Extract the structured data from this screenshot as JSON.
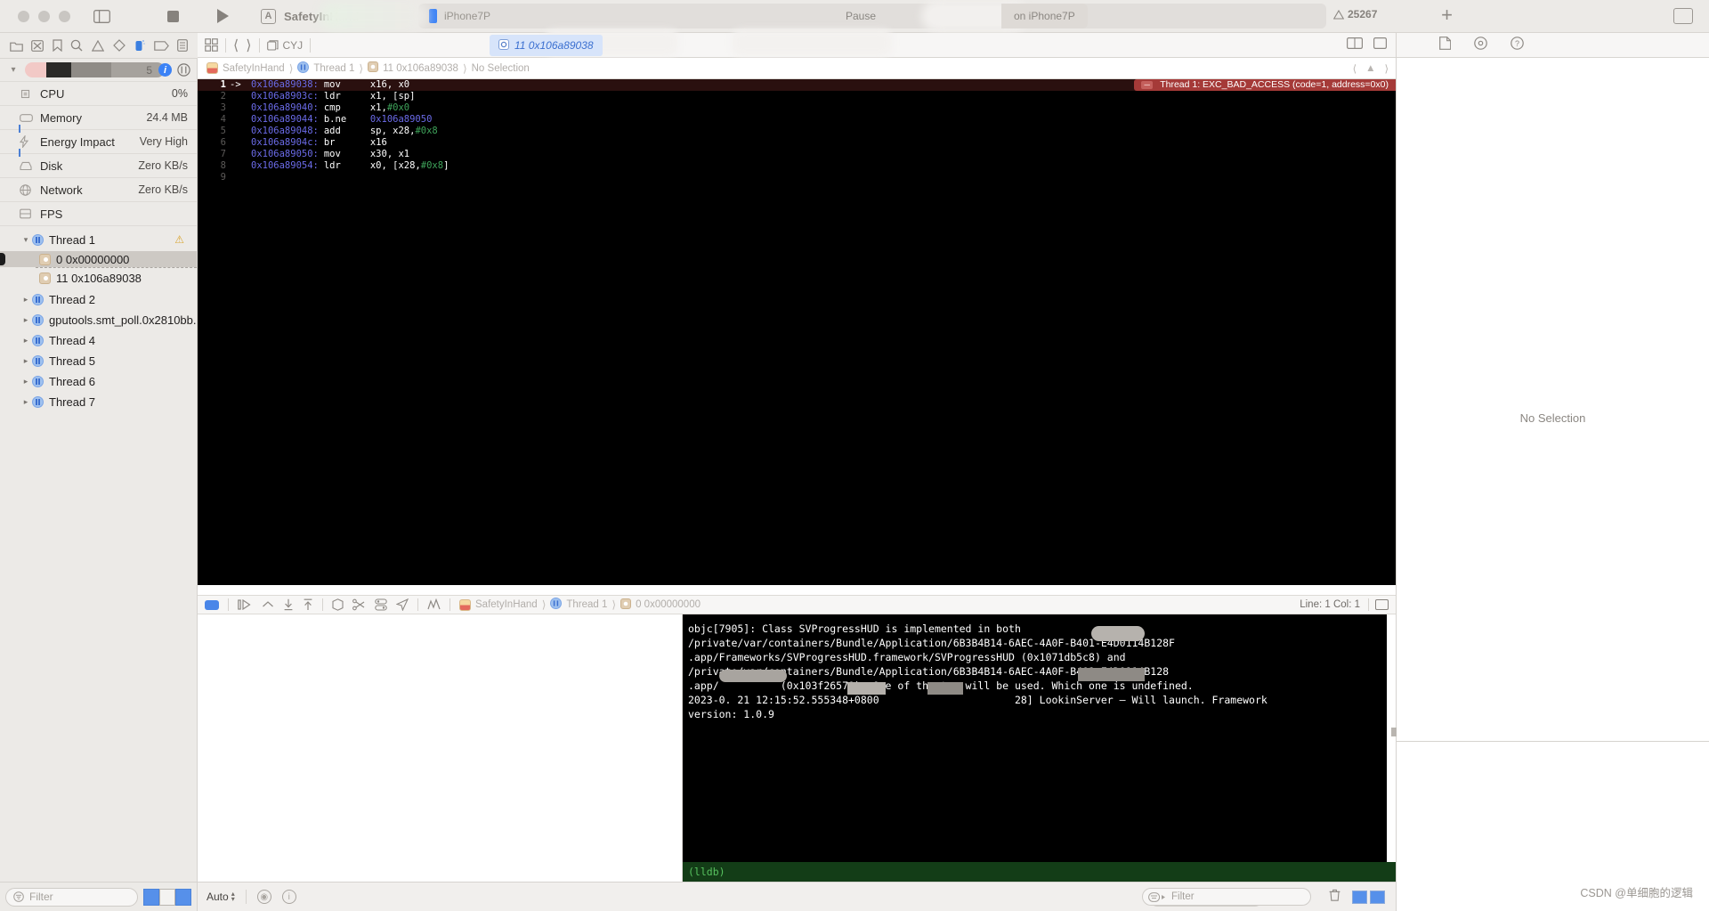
{
  "toolbar": {
    "scheme_name": "SafetyInHand",
    "device_name": "iPhone7P",
    "status_text": "Pause",
    "target_text": "on iPhone7P",
    "warning_count": "25267",
    "stop_icon": "stop-icon",
    "run_icon": "run-icon",
    "sidebar_toggle_icon": "sidebar-toggle-icon",
    "add_icon": "plus-icon",
    "inspector_toggle_icon": "inspector-toggle-icon",
    "app_badge_glyph": "A"
  },
  "navigator": {
    "filter_icons": [
      "folder-icon",
      "source-control-icon",
      "bookmark-icon",
      "search-icon",
      "issue-warning-icon",
      "test-diamond-icon",
      "debug-gauge-icon",
      "breakpoint-icon",
      "report-icon"
    ],
    "gauge_row": {
      "value": "5"
    },
    "metrics": [
      {
        "icon": "cpu-icon",
        "label": "CPU",
        "value": "0%"
      },
      {
        "icon": "memory-icon",
        "label": "Memory",
        "value": "24.4 MB"
      },
      {
        "icon": "energy-icon",
        "label": "Energy Impact",
        "value": "Very High"
      },
      {
        "icon": "disk-icon",
        "label": "Disk",
        "value": "Zero KB/s"
      },
      {
        "icon": "network-icon",
        "label": "Network",
        "value": "Zero KB/s"
      },
      {
        "icon": "fps-icon",
        "label": "FPS",
        "value": ""
      }
    ],
    "threads": [
      {
        "label": "Thread 1",
        "expanded": true,
        "warning": "⚠",
        "kind": "thread"
      },
      {
        "label": "0 0x00000000",
        "kind": "frame",
        "selected": true
      },
      {
        "label": "11 0x106a89038",
        "kind": "frame",
        "selected": false
      },
      {
        "label": "Thread 2",
        "expanded": false,
        "kind": "thread"
      },
      {
        "label": "gputools.smt_poll.0x2810bb...",
        "expanded": false,
        "kind": "thread"
      },
      {
        "label": "Thread 4",
        "expanded": false,
        "kind": "thread"
      },
      {
        "label": "Thread 5",
        "expanded": false,
        "kind": "thread"
      },
      {
        "label": "Thread 6",
        "expanded": false,
        "kind": "thread"
      },
      {
        "label": "Thread 7",
        "expanded": false,
        "kind": "thread"
      }
    ],
    "filter_placeholder": "Filter"
  },
  "jumpbar": {
    "grid_icon": "related-items-icon",
    "back_icon": "back-chevron-icon",
    "forward_icon": "forward-chevron-icon",
    "project_chip": "CYJ",
    "active_tab": "11 0x106a89038"
  },
  "breadcrumb": {
    "items": [
      "SafetyInHand",
      "Thread 1",
      "11 0x106a89038",
      "No Selection"
    ],
    "separator": "⟩"
  },
  "editor": {
    "error_banner": "Thread 1: EXC_BAD_ACCESS (code=1, address=0x0)",
    "pc_marker": "->",
    "lines": [
      {
        "n": "1",
        "pc": true,
        "addr": "0x106a89038:",
        "mnem": "mov",
        "ops": "x16, x0",
        "imm": ""
      },
      {
        "n": "2",
        "pc": false,
        "addr": "0x106a8903c:",
        "mnem": "ldr",
        "ops": "x1, [sp]",
        "imm": ""
      },
      {
        "n": "3",
        "pc": false,
        "addr": "0x106a89040:",
        "mnem": "cmp",
        "ops": "x1, ",
        "imm": "#0x0"
      },
      {
        "n": "4",
        "pc": false,
        "addr": "0x106a89044:",
        "mnem": "b.ne",
        "ops": "",
        "imm": "",
        "jump": "0x106a89050"
      },
      {
        "n": "5",
        "pc": false,
        "addr": "0x106a89048:",
        "mnem": "add",
        "ops": "sp, x28, ",
        "imm": "#0x8"
      },
      {
        "n": "6",
        "pc": false,
        "addr": "0x106a8904c:",
        "mnem": "br",
        "ops": "x16",
        "imm": ""
      },
      {
        "n": "7",
        "pc": false,
        "addr": "0x106a89050:",
        "mnem": "mov",
        "ops": "x30, x1",
        "imm": ""
      },
      {
        "n": "8",
        "pc": false,
        "addr": "0x106a89054:",
        "mnem": "ldr",
        "ops": "x0, [x28, ",
        "imm": "#0x8",
        "tail": "]"
      },
      {
        "n": "9",
        "pc": false,
        "addr": "",
        "mnem": "",
        "ops": "",
        "imm": ""
      }
    ],
    "status": {
      "line_col": "Line: 1  Col: 1"
    }
  },
  "debug_bar": {
    "icons": [
      "continue-icon",
      "step-over-icon",
      "step-into-icon",
      "step-out-icon",
      "view-hierarchy-icon",
      "memory-graph-icon",
      "environment-overrides-icon",
      "simulate-location-icon",
      "gpu-debug-icon"
    ],
    "crumbs": [
      "SafetyInHand",
      "Thread 1",
      "0 0x00000000"
    ]
  },
  "console": {
    "lines": [
      "objc[7905]: Class SVProgressHUD is implemented in both",
      "/private/var/containers/Bundle/Application/6B3B4B14-6AEC-4A0F-B401-E4D0114B128F",
      ".app/Frameworks/SVProgressHUD.framework/SVProgressHUD (0x1071db5c8) and",
      "/private/var/containers/Bundle/Application/6B3B4B14-6AEC-4A0F-B401-E4D0114B128",
      ".app/          (0x103f26570). One of the two will be used. Which one is undefined.",
      "2023-0. 21 12:15:52.555348+0800                      28] LookinServer — Will launch. Framework",
      "version: 1.0.9"
    ],
    "prompt": "(lldb)"
  },
  "debug_footer": {
    "auto_label": "Auto",
    "variables_filter_placeholder": "Filter",
    "console_filter_placeholder": "Filter",
    "trash_icon": "trash-icon",
    "eye_icon": "eye-icon",
    "info_icon": "info-icon"
  },
  "inspector": {
    "icons": [
      "file-inspector-icon",
      "quick-help-icon",
      "help-icon"
    ],
    "no_selection": "No Selection"
  },
  "watermark": "CSDN @单细胞的逻辑",
  "colors": {
    "chrome": "#eceae7",
    "editor_bg": "#000000",
    "error_red": "#a53a38",
    "accent_blue": "#3b82f6",
    "lldb_green": "#133d17",
    "addr_purple": "#6b6be8",
    "imm_green": "#3ea35a"
  }
}
